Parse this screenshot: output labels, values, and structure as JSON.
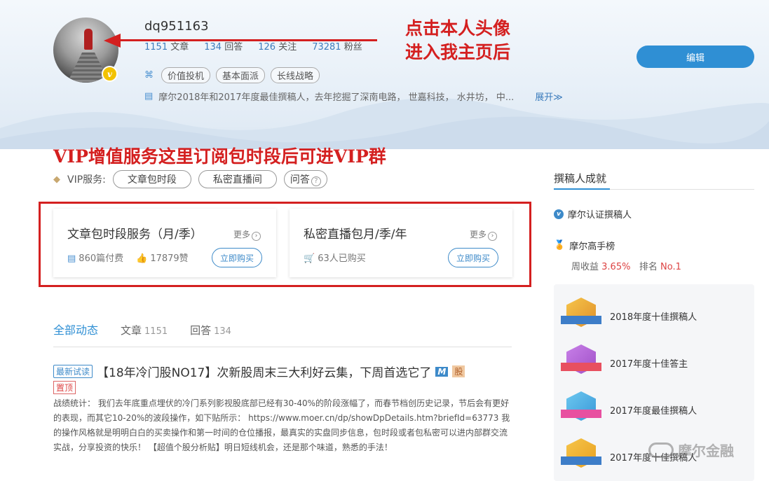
{
  "profile": {
    "username": "dq951163",
    "stats": [
      {
        "num": "1151",
        "label": "文章"
      },
      {
        "num": "134",
        "label": "回答"
      },
      {
        "num": "126",
        "label": "关注"
      },
      {
        "num": "73281",
        "label": "粉丝"
      }
    ],
    "tags": [
      "价值投机",
      "基本面派",
      "长线战略"
    ],
    "bio": "摩尔2018年和2017年度最佳撰稿人，去年挖掘了深南电路，  世嘉科技，  水井坊，  中...",
    "expand_label": "展开",
    "edit_label": "编辑"
  },
  "annotations": {
    "avatar_note_line1": "点击本人头像",
    "avatar_note_line2": "进入我主页后",
    "vip_note": "VIP增值服务这里订阅包时段后可进VIP群"
  },
  "vip": {
    "label": "VIP服务:",
    "pills": [
      "文章包时段",
      "私密直播间",
      "问答"
    ]
  },
  "cards": [
    {
      "title": "文章包时段服务（月/季）",
      "more": "更多",
      "meta1": "860篇付费",
      "meta2": "17879赞",
      "buy": "立即购买"
    },
    {
      "title": "私密直播包月/季/年",
      "more": "更多",
      "meta1": "63人已购买",
      "buy": "立即购买"
    }
  ],
  "tabs": [
    {
      "label": "全部动态",
      "count": ""
    },
    {
      "label": "文章",
      "count": "1151"
    },
    {
      "label": "回答",
      "count": "134"
    }
  ],
  "article": {
    "badge_new": "最新试读",
    "title": "【18年冷门股NO17】次新股周末三大利好云集，下周首选它了",
    "badge_m": "M",
    "badge_gu": "股",
    "badge_top": "置顶",
    "body": "战绩统计： 我们去年底重点埋伏的冷门系列影视股底部已经有30-40%的阶段涨幅了，而春节档创历史记录，节后会有更好的表现，而其它10-20%的波段操作，如下贴所示：   https://www.moer.cn/dp/showDpDetails.htm?briefId=63773  我的操作风格就是明明白白的买卖操作和第一时间的仓位播报，最真实的实盘同步信息，包时段或者包私密可以进内部群交流实战，分享投资的快乐！   【超值个股分析贴】明日短线机会，还是那个味道，熟悉的手法！"
  },
  "sidebar": {
    "title": "撰稿人成就",
    "ach1": "摩尔认证撰稿人",
    "ach2": "摩尔高手榜",
    "weekly_label": "周收益",
    "weekly_value": "3.65%",
    "rank_label": "排名",
    "rank_value": "No.1",
    "honors": [
      "2018年度十佳撰稿人",
      "2017年度十佳答主",
      "2017年度最佳撰稿人",
      "2017年度十佳撰稿人"
    ]
  },
  "watermark": "摩尔金融",
  "colors": {
    "accent": "#2f8fd4",
    "annotation_red": "#d42020"
  }
}
